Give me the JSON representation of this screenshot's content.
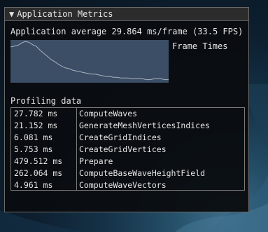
{
  "window": {
    "title": "Application Metrics",
    "collapse_glyph": "▼"
  },
  "metrics": {
    "average_text": "Application average 29.864 ms/frame (33.5 FPS)"
  },
  "frame_plot": {
    "label": "Frame Times",
    "chart_data": {
      "type": "line",
      "title": "",
      "xlabel": "",
      "ylabel": "",
      "series": [
        {
          "values": [
            46,
            47,
            48,
            51,
            53,
            52,
            49,
            47,
            42,
            38,
            34,
            30,
            27,
            24,
            21,
            19,
            18,
            16,
            15,
            14,
            13,
            12,
            11,
            11,
            10,
            9,
            8,
            8,
            7,
            7,
            6,
            6,
            6,
            5,
            5,
            5,
            5,
            4,
            4,
            5,
            5,
            5,
            4,
            4
          ]
        }
      ],
      "ylim": [
        0,
        55
      ],
      "grid": false
    }
  },
  "profiling": {
    "label": "Profiling data",
    "rows": [
      {
        "time": "27.782 ms",
        "name": "ComputeWaves"
      },
      {
        "time": "21.152 ms",
        "name": "GenerateMeshVerticesIndices"
      },
      {
        "time": "6.081 ms",
        "name": "CreateGridIndices"
      },
      {
        "time": "5.753 ms",
        "name": "CreateGridVertices"
      },
      {
        "time": "479.512 ms",
        "name": "Prepare"
      },
      {
        "time": "262.064 ms",
        "name": "ComputeBaseWaveHeightField"
      },
      {
        "time": "4.961 ms",
        "name": "ComputeWaveVectors"
      }
    ]
  },
  "colors": {
    "plot_background": "#3b4e66",
    "plot_line": "#a8b2bd",
    "window_background": "#0a0c0f",
    "title_background": "#2c2c2c",
    "text": "#e6e6e6",
    "border": "#7a7a7a"
  }
}
